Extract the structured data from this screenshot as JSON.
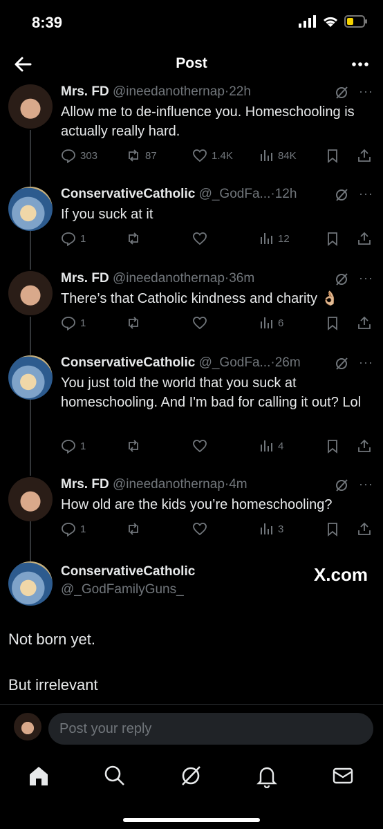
{
  "status": {
    "time": "8:39"
  },
  "header": {
    "title": "Post"
  },
  "tweets": [
    {
      "name": "Mrs. FD",
      "handle": "@ineedanothernap",
      "time": "22h",
      "text": "Allow me to de-influence you. Homeschooling is actually really hard.",
      "replies": "303",
      "retweets": "87",
      "likes": "1.4K",
      "views": "84K",
      "emoji": ""
    },
    {
      "name": "ConservativeCatholic",
      "handle": "@_GodFa...",
      "time": "12h",
      "text": "If you suck at it",
      "replies": "1",
      "retweets": "",
      "likes": "",
      "views": "12",
      "emoji": ""
    },
    {
      "name": "Mrs. FD",
      "handle": "@ineedanothernap",
      "time": "36m",
      "text": "There’s that Catholic kindness and charity",
      "replies": "1",
      "retweets": "",
      "likes": "",
      "views": "6",
      "emoji": "👌🏼"
    },
    {
      "name": "ConservativeCatholic",
      "handle": "@_GodFa...",
      "time": "26m",
      "text": "You just told the world that you suck at homeschooling. And I'm bad for calling it out? Lol",
      "replies": "1",
      "retweets": "",
      "likes": "",
      "views": "4",
      "emoji": ""
    },
    {
      "name": "Mrs. FD",
      "handle": "@ineedanothernap",
      "time": "4m",
      "text": "How old are the kids you’re homeschooling?",
      "replies": "1",
      "retweets": "",
      "likes": "",
      "views": "3",
      "emoji": ""
    }
  ],
  "main_tweet": {
    "name": "ConservativeCatholic",
    "handle": "@_GodFamilyGuns_",
    "watermark": "X.com",
    "line1": "Not born yet.",
    "line2": "But irrelevant"
  },
  "reply": {
    "placeholder": "Post your reply"
  },
  "separator": "·",
  "more_glyph": "···"
}
